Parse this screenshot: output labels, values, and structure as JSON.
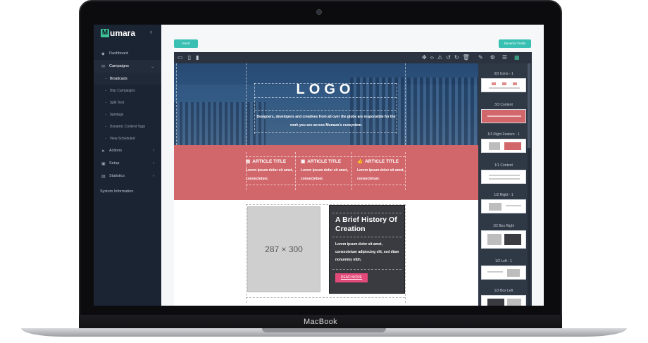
{
  "device": {
    "brand": "MacBook"
  },
  "sidebar": {
    "app_name": "umara",
    "logo_letter": "M",
    "collapse_icon": "chevron-left-icon",
    "items": [
      {
        "label": "Dashboard",
        "icon": "dashboard-icon"
      },
      {
        "label": "Campaigns",
        "icon": "campaign-icon",
        "expanded": true
      },
      {
        "label": "Actions",
        "icon": "actions-icon"
      },
      {
        "label": "Setup",
        "icon": "setup-icon"
      },
      {
        "label": "Statistics",
        "icon": "statistics-icon"
      }
    ],
    "subitems": [
      {
        "label": "Broadcasts",
        "selected": true
      },
      {
        "label": "Drip Campaigns"
      },
      {
        "label": "Split Test"
      },
      {
        "label": "Spintags"
      },
      {
        "label": "Dynamic Content Tags"
      },
      {
        "label": "View Scheduled"
      }
    ],
    "system_information": "System Information"
  },
  "header": {
    "insert_button": "Insert",
    "dynamic_fields_button": "Dynamic Fields"
  },
  "canvas": {
    "logo_text": "LOGO",
    "hero_description": "Designers, developers and creatives from all over the globe are responsible for the work you see across Mumara's ecosystem.",
    "columns": [
      {
        "title": "ARTICLE TITLE",
        "text": "Lorem ipsum dolor sit amet, consectetuer.",
        "icon": "newspaper-icon"
      },
      {
        "title": "ARTICLE TITLE",
        "text": "Lorem ipsum dolor sit amet, consectetuer.",
        "icon": "print-icon"
      },
      {
        "title": "ARTICLE TITLE",
        "text": "Lorem ipsum dolor sit amet, consectetuer.",
        "icon": "thumbs-up-icon"
      }
    ],
    "placeholder_text": "287 × 300",
    "feature_title": "A Brief History Of Creation",
    "feature_text": "Lorem ipsum dolor sit amet, consectetuer adipiscing elit, sed diam nonummy nibh.",
    "feature_button": "READ MORE"
  },
  "blocks_panel": {
    "blocks": [
      {
        "label": "3/3 Icons - 1"
      },
      {
        "label": "3/3 Content"
      },
      {
        "label": "1/3 Right Feature - 1"
      },
      {
        "label": "1/1 Content"
      },
      {
        "label": "1/2 Right - 1"
      },
      {
        "label": "1/2 Box Right"
      },
      {
        "label": "1/2 Left - 1"
      },
      {
        "label": "1/2 Box Left"
      }
    ]
  },
  "colors": {
    "sidebar_bg": "#1b2432",
    "accent_teal": "#39c0b2",
    "band_red": "#d2676b",
    "read_more_pink": "#e44a79",
    "toolbar_bg": "#2b3340"
  }
}
